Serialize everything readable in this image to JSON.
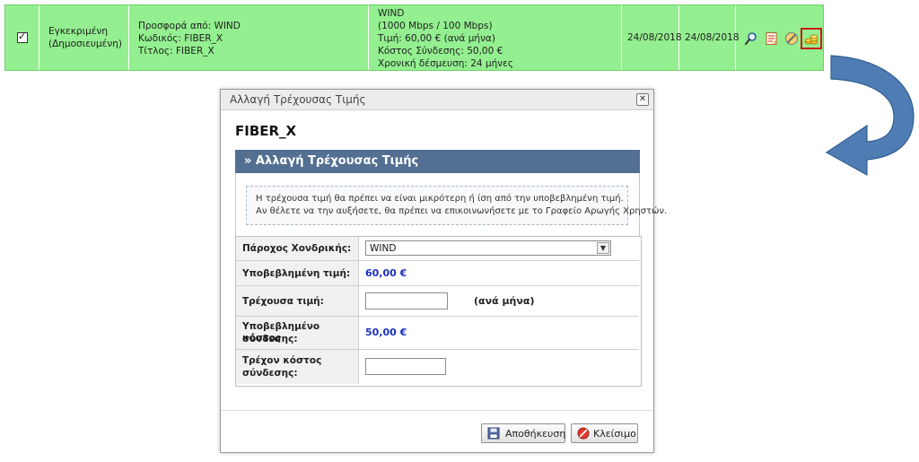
{
  "offer_row": {
    "status_line1": "Εγκεκριμένη",
    "status_line2": "(Δημοσιευμένη)",
    "offer_from": "Προσφορά από: WIND",
    "code": "Κωδικός: FIBER_X",
    "title": "Τίτλος: FIBER_X",
    "provider": "WIND",
    "speed": "(1000 Mbps / 100 Mbps)",
    "price": "Τιμή: 60,00 € (ανά μήνα)",
    "connection_cost": "Κόστος Σύνδεσης: 50,00 €",
    "commitment": "Χρονική δέσμευση: 24 μήνες",
    "date_from": "24/08/2018",
    "date_to": "24/08/2018",
    "actions": [
      {
        "icon": "view-icon"
      },
      {
        "icon": "edit-report-icon"
      },
      {
        "icon": "cancel-icon"
      },
      {
        "icon": "change-price-icon",
        "highlighted": true
      }
    ],
    "colors": {
      "row_bg": "#93ef8f",
      "highlight": "#d01818"
    }
  },
  "arrow": {
    "color": "#4f7db3"
  },
  "dialog": {
    "window_title": "Αλλαγή Τρέχουσας Τιμής",
    "close_symbol": "✕",
    "offer_name": "FIBER_X",
    "panel_title": "» Αλλαγή Τρέχουσας Τιμής",
    "info_line1": "Η τρέχουσα τιμή θα πρέπει να είναι μικρότερη ή ίση από την υποβεβλημένη τιμή.",
    "info_line2": "Αν θέλετε να την αυξήσετε, θα πρέπει να επικοινωνήσετε με το Γραφείο Αρωγής Χρηστών.",
    "fields": {
      "wholesale_provider_label": "Πάροχος Χονδρικής:",
      "wholesale_provider_value": "WIND",
      "submitted_price_label": "Υποβεβλημένη τιμή:",
      "submitted_price_value": "60,00 €",
      "current_price_label": "Τρέχουσα τιμή:",
      "current_price_value": "",
      "per_month": "(ανά μήνα)",
      "submitted_conn_label_1": "Υποβεβλημένο κόστος",
      "submitted_conn_label_2": "σύνδεσης:",
      "submitted_conn_value": "50,00 €",
      "current_conn_label_1": "Τρέχον κόστος",
      "current_conn_label_2": "σύνδεσης:",
      "current_conn_value": ""
    },
    "buttons": {
      "save_label": "Αποθήκευση",
      "close_label": "Κλείσιμο"
    },
    "colors": {
      "panel_bar": "#536f92",
      "price_blue": "#1a2fbf"
    }
  }
}
